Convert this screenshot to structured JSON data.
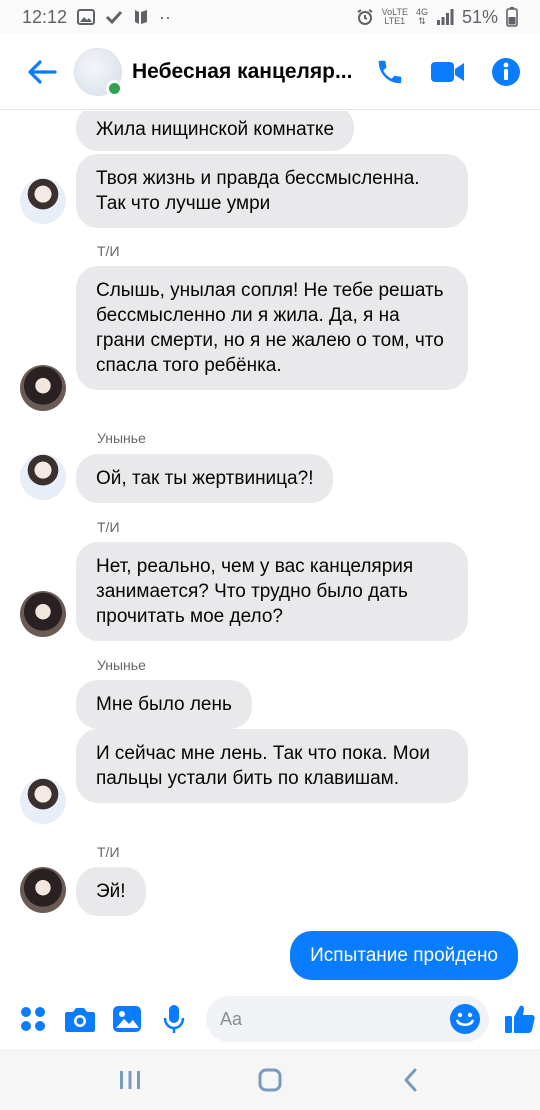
{
  "status_bar": {
    "time": "12:12",
    "dots": "··",
    "network_top": "VoLTE",
    "network_label": "LTE1",
    "network_type": "4G",
    "battery": "51%"
  },
  "header": {
    "title": "Небесная канцелярия",
    "title_display": "Небесная канцеляр...",
    "online": true
  },
  "messages": [
    {
      "side": "in",
      "text": "Жила нищинской комнатке"
    },
    {
      "side": "in",
      "text": "Твоя жизнь и правда бессмысленна. Так что лучше умри"
    },
    {
      "side": "in",
      "sender": "Т/И",
      "text": "Слышь, унылая сопля! Не тебе решать бессмысленно ли я жила. Да, я на грани смерти, но я не жалею о том, что спасла того ребёнка."
    },
    {
      "side": "in",
      "sender": "Унынье",
      "text": "Ой, так ты жертвиница?!"
    },
    {
      "side": "in",
      "sender": "Т/И",
      "text": "Нет, реально, чем у вас канцелярия занимается? Что трудно было дать прочитать мое дело?"
    },
    {
      "side": "in",
      "sender": "Унынье",
      "text": "Мне было лень"
    },
    {
      "side": "in",
      "text": "И сейчас мне лень. Так что пока. Мои пальцы устали бить по клавишам."
    },
    {
      "side": "in",
      "sender": "Т/И",
      "text": "Эй!"
    },
    {
      "side": "out",
      "text": "Испытание пройдено"
    }
  ],
  "composer": {
    "placeholder": "Aa",
    "value": ""
  },
  "colors": {
    "accent": "#0a7cff",
    "messenger_blue": "#0084ff",
    "incoming_bubble": "#e9e9eb",
    "online": "#31a24c"
  },
  "icons": {
    "back": "arrow-left-icon",
    "call": "phone-icon",
    "video": "video-camera-icon",
    "info": "info-icon",
    "apps": "four-dots-icon",
    "camera": "camera-icon",
    "gallery": "image-icon",
    "mic": "microphone-icon",
    "emoji": "smiley-icon",
    "like": "thumbs-up-icon"
  }
}
